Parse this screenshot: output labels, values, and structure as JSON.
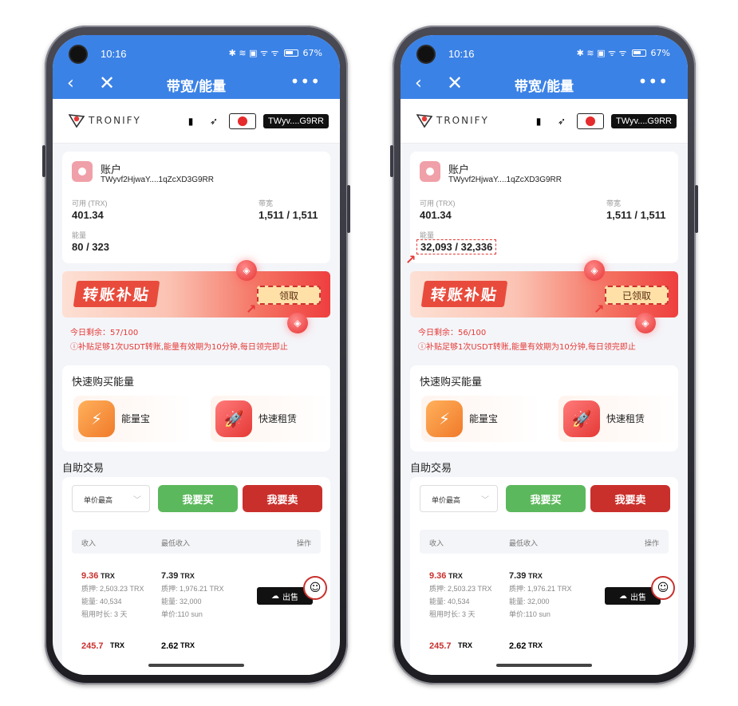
{
  "phones": [
    {
      "status": {
        "time": "10:16",
        "icons": "✱ ≋ ▣ ᯤ ᯤ",
        "battery": "67%"
      },
      "nav": {
        "back": "‹",
        "close": "✕",
        "title": "带宽/能量",
        "more": "•••"
      },
      "brand": {
        "logo_text": "TRONIFY",
        "wallet": "TWyv....G9RR"
      },
      "account": {
        "title": "账户",
        "address": "TWyvf2HjwaY....1qZcXD3G9RR",
        "available_label": "可用 (TRX)",
        "available_value": "401.34",
        "bandwidth_label": "带宽",
        "bandwidth_value": "1,511 / 1,511",
        "energy_label": "能量",
        "energy_value": "80 / 323"
      },
      "banner": {
        "title": "转账补贴",
        "button": "领取"
      },
      "remain": "今日剩余：57/100",
      "notice": "ⓘ补贴足够1次USDT转账,能量有效期为10分钟,每日领完即止",
      "quick": {
        "title": "快速购买能量",
        "item1": "能量宝",
        "item2": "快速租赁"
      },
      "trade": {
        "title": "自助交易",
        "select": "单价最高",
        "buy": "我要买",
        "sell": "我要卖",
        "col1": "收入",
        "col2": "最低收入",
        "col3": "操作",
        "row1": {
          "income": "9.36",
          "income_unit": "TRX",
          "pledge": "质押: 2,503.23 TRX",
          "energy": "能量: 40,534",
          "duration": "租用时长: 3 天",
          "min_income": "7.39",
          "min_unit": "TRX",
          "min_pledge": "质押: 1,976.21 TRX",
          "min_energy": "能量: 32,000",
          "price": "单价:110 sun",
          "action": "出售"
        },
        "row2": {
          "income": "245.7",
          "income_unit": "TRX",
          "min_income": "2.62",
          "min_unit": "TRX"
        }
      }
    },
    {
      "status": {
        "time": "10:16",
        "icons": "✱ ≋ ▣ ᯤ ᯤ",
        "battery": "67%"
      },
      "nav": {
        "back": "‹",
        "close": "✕",
        "title": "带宽/能量",
        "more": "•••"
      },
      "brand": {
        "logo_text": "TRONIFY",
        "wallet": "TWyv....G9RR"
      },
      "account": {
        "title": "账户",
        "address": "TWyvf2HjwaY....1qZcXD3G9RR",
        "available_label": "可用 (TRX)",
        "available_value": "401.34",
        "bandwidth_label": "带宽",
        "bandwidth_value": "1,511 / 1,511",
        "energy_label": "能量",
        "energy_value": "32,093 / 32,336"
      },
      "banner": {
        "title": "转账补贴",
        "button": "已领取"
      },
      "remain": "今日剩余：56/100",
      "notice": "ⓘ补贴足够1次USDT转账,能量有效期为10分钟,每日领完即止",
      "quick": {
        "title": "快速购买能量",
        "item1": "能量宝",
        "item2": "快速租赁"
      },
      "trade": {
        "title": "自助交易",
        "select": "单价最高",
        "buy": "我要买",
        "sell": "我要卖",
        "col1": "收入",
        "col2": "最低收入",
        "col3": "操作",
        "row1": {
          "income": "9.36",
          "income_unit": "TRX",
          "pledge": "质押: 2,503.23 TRX",
          "energy": "能量: 40,534",
          "duration": "租用时长: 3 天",
          "min_income": "7.39",
          "min_unit": "TRX",
          "min_pledge": "质押: 1,976.21 TRX",
          "min_energy": "能量: 32,000",
          "price": "单价:110 sun",
          "action": "出售"
        },
        "row2": {
          "income": "245.7",
          "income_unit": "TRX",
          "min_income": "2.62",
          "min_unit": "TRX"
        }
      }
    }
  ],
  "colors": {
    "topbar": "#3b82e6",
    "buy": "#5cb85c",
    "sell": "#c9302c",
    "highlight": "#e53935"
  }
}
